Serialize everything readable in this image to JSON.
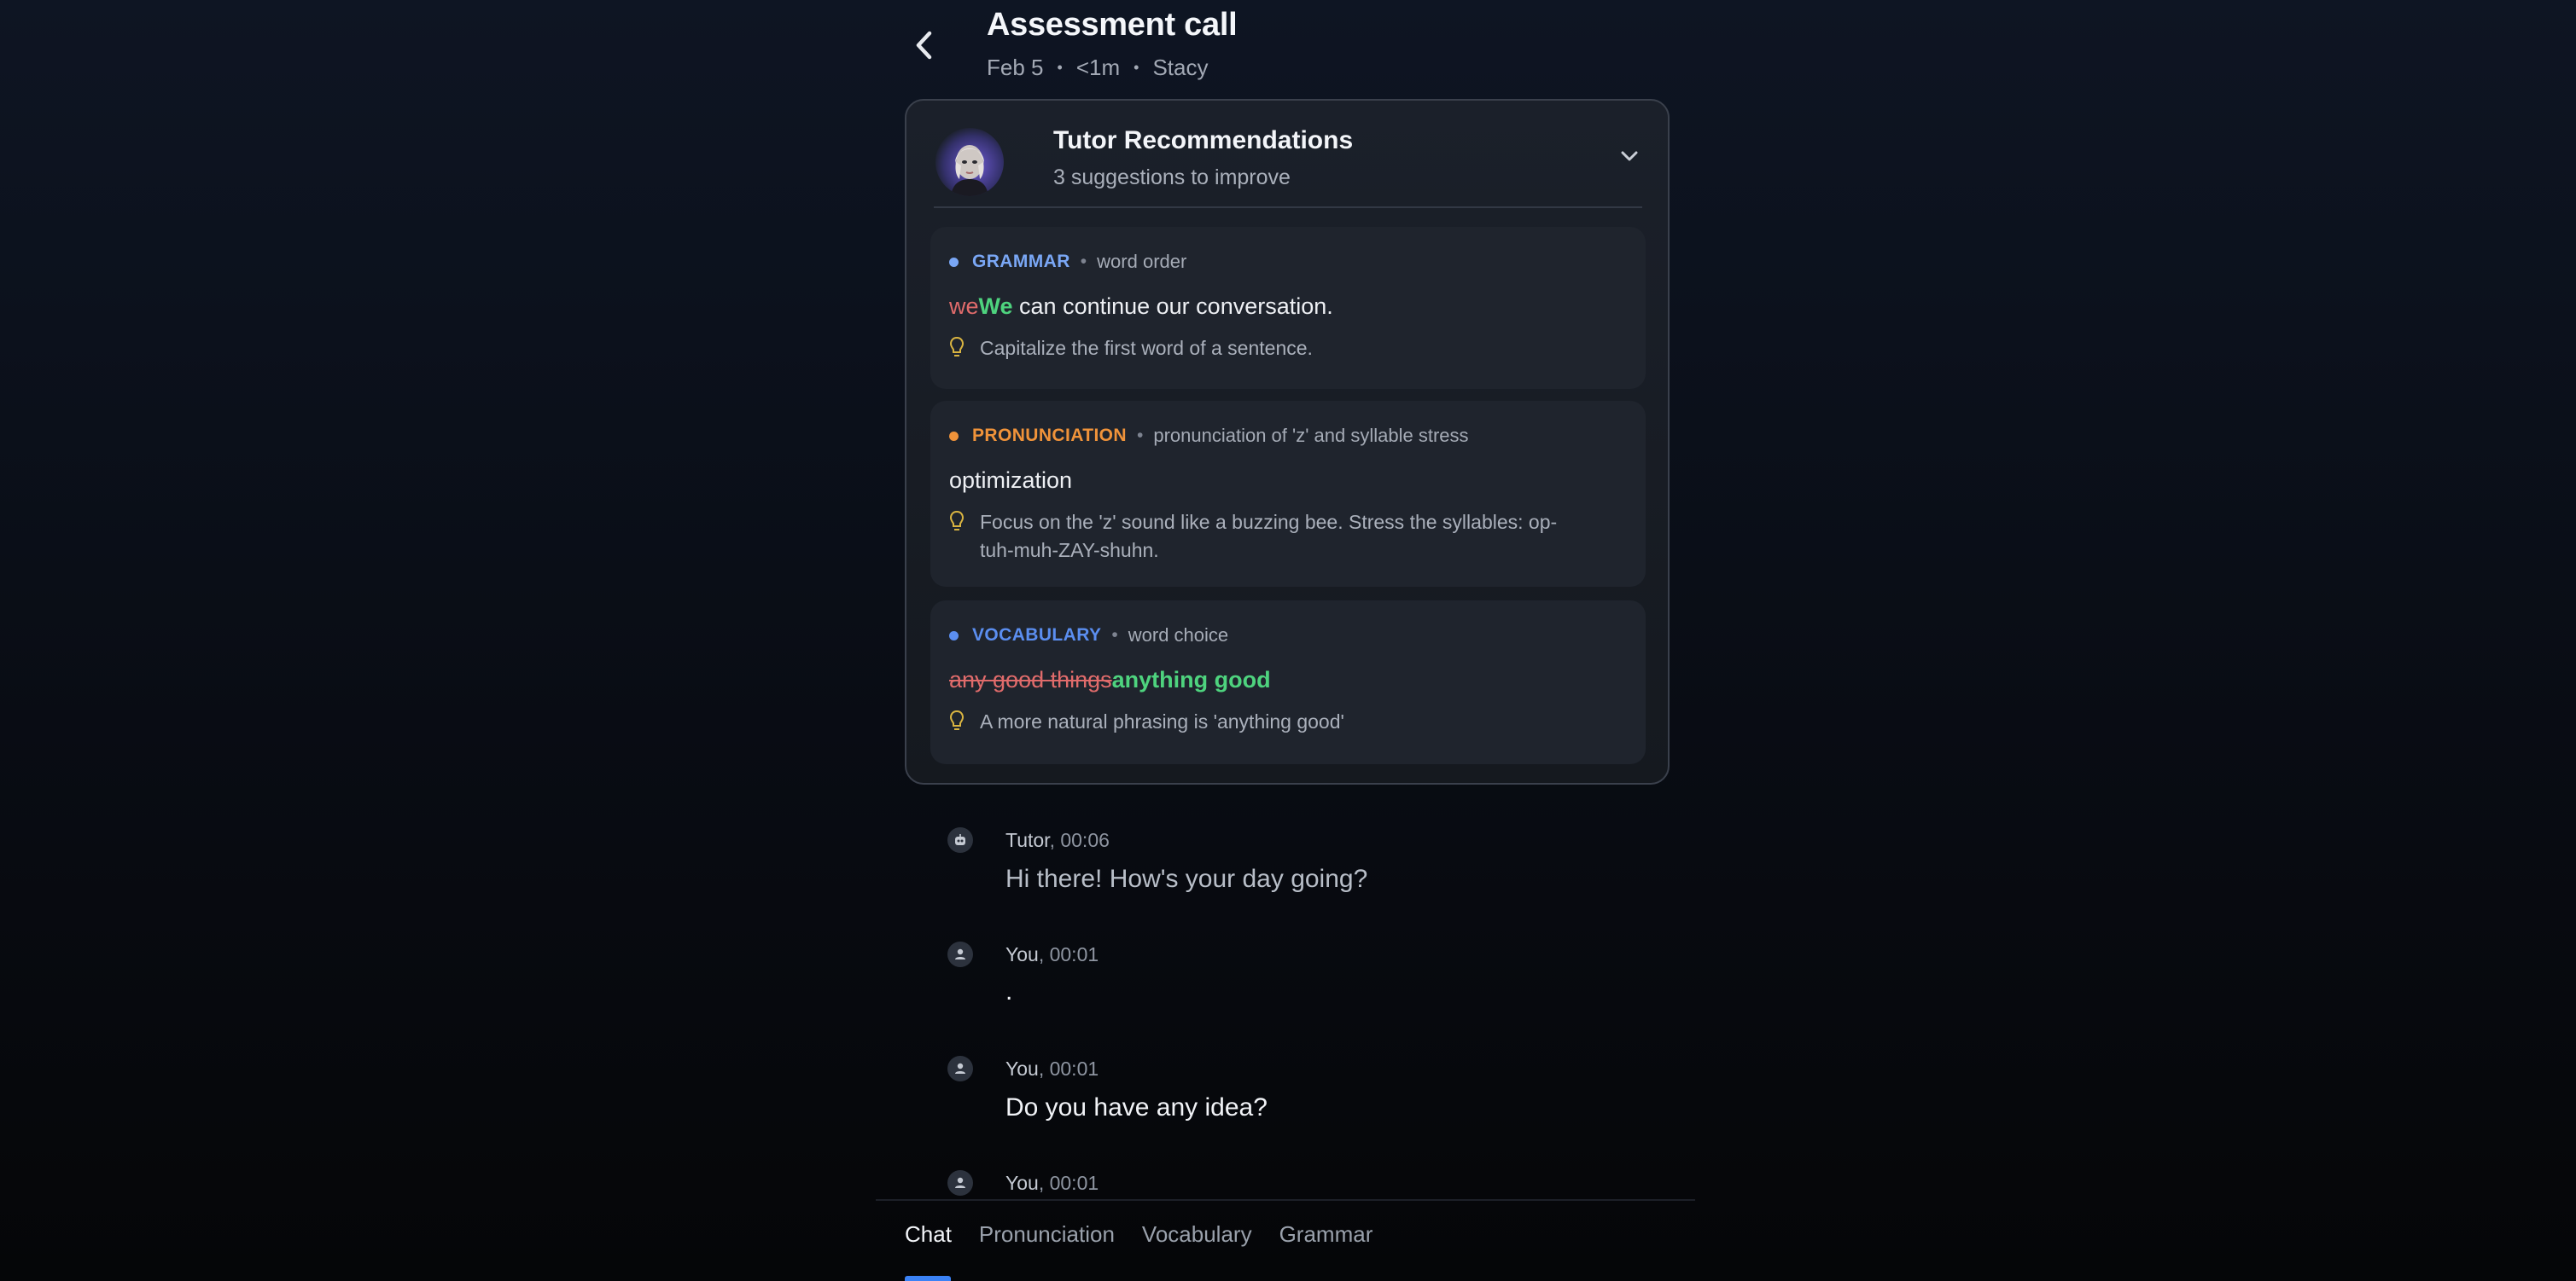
{
  "header": {
    "title": "Assessment call",
    "date": "Feb 5",
    "duration": "<1m",
    "tutor_name": "Stacy",
    "separator": "•"
  },
  "recommendations": {
    "title": "Tutor Recommendations",
    "subtitle": "3 suggestions to improve",
    "items": [
      {
        "category": "GRAMMAR",
        "category_color": "#7aa7f5",
        "bullet_color": "#7aa7f5",
        "topic": "word order",
        "old": "we",
        "new": "We",
        "rest": " can continue our conversation.",
        "tip": "Capitalize the first word of a sentence."
      },
      {
        "category": "PRONUNCIATION",
        "category_color": "#f0933a",
        "bullet_color": "#f0933a",
        "topic": "pronunciation of 'z' and syllable stress",
        "word": "optimization",
        "tip_line1": "Focus on the 'z' sound like a buzzing bee. Stress the syllables: op-",
        "tip_line2": "tuh-muh-ZAY-shuhn."
      },
      {
        "category": "VOCABULARY",
        "category_color": "#5b8ef0",
        "bullet_color": "#5b8ef0",
        "topic": "word choice",
        "old": "any good things",
        "new": "anything good",
        "tip": "A more natural phrasing is 'anything good'"
      }
    ],
    "topic_separator": "•"
  },
  "chat": [
    {
      "who": "Tutor",
      "time": ", 00:06",
      "text": "Hi there! How's your day going?",
      "icon": "robot-icon"
    },
    {
      "who": "You",
      "time": ", 00:01",
      "text": ".",
      "icon": "user-icon"
    },
    {
      "who": "You",
      "time": ", 00:01",
      "text": "Do you have any idea?",
      "icon": "user-icon"
    },
    {
      "who": "You",
      "time": ", 00:01",
      "text": "",
      "icon": "user-icon"
    }
  ],
  "tabs": [
    "Chat",
    "Pronunciation",
    "Vocabulary",
    "Grammar"
  ],
  "active_tab": "Chat",
  "colors": {
    "accent": "#3b82f6",
    "correct": "#4ed37e",
    "incorrect": "#e06b6b",
    "tip_bulb": "#d9b441"
  }
}
